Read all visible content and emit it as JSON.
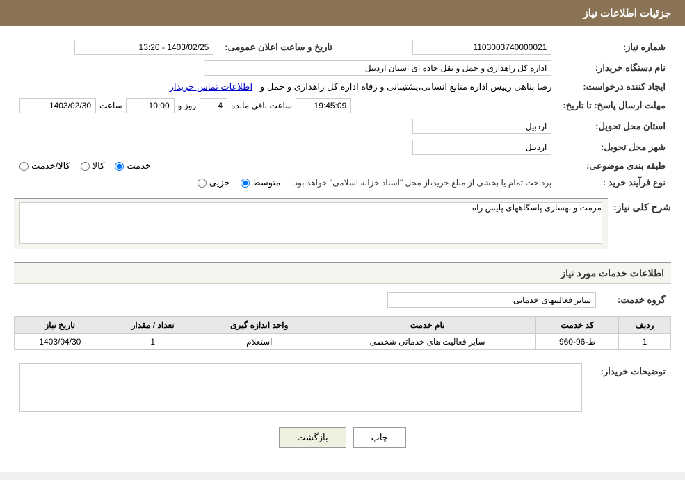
{
  "header": {
    "title": "جزئیات اطلاعات نیاز"
  },
  "fields": {
    "need_number_label": "شماره نیاز:",
    "need_number_value": "1103003740000021",
    "announce_date_label": "تاریخ و ساعت اعلان عمومی:",
    "announce_date_value": "1403/02/25 - 13:20",
    "buyer_org_label": "نام دستگاه خریدار:",
    "buyer_org_value": "اداره کل راهداری و حمل و نقل جاده ای استان اردبیل",
    "creator_label": "ایجاد کننده درخواست:",
    "creator_value": "رضا بناهی رییس اداره منابع انسانی،پشتیبانی و رفاه اداره کل راهداری و حمل و",
    "creator_link": "اطلاعات تماس خریدار",
    "deadline_label": "مهلت ارسال پاسخ: تا تاریخ:",
    "deadline_date": "1403/02/30",
    "deadline_time_label": "ساعت",
    "deadline_time": "10:00",
    "deadline_day_label": "روز و",
    "deadline_days": "4",
    "deadline_remaining_label": "ساعت باقی مانده",
    "deadline_remaining": "19:45:09",
    "province_label": "استان محل تحویل:",
    "province_value": "اردبیل",
    "city_label": "شهر محل تحویل:",
    "city_value": "اردبیل",
    "category_label": "طبقه بندی موضوعی:",
    "category_options": [
      "کالا",
      "خدمت",
      "کالا/خدمت"
    ],
    "category_selected": "خدمت",
    "purchase_type_label": "نوع فرآیند خرید :",
    "purchase_type_options": [
      "جزیی",
      "متوسط"
    ],
    "purchase_type_selected": "متوسط",
    "purchase_type_note": "پرداخت تمام یا بخشی از مبلغ خرید،از محل \"اسناد خزانه اسلامی\" خواهد بود."
  },
  "need_description": {
    "section_label": "شرح کلی نیاز:",
    "value": "مرمت و بهسازی پاسگاههای پلیس راه"
  },
  "services_section": {
    "title": "اطلاعات خدمات مورد نیاز",
    "service_group_label": "گروه خدمت:",
    "service_group_value": "سایر فعالیتهای خدماتی",
    "table_headers": [
      "ردیف",
      "کد خدمت",
      "نام خدمت",
      "واحد اندازه گیری",
      "تعداد / مقدار",
      "تاریخ نیاز"
    ],
    "table_rows": [
      {
        "row_num": "1",
        "service_code": "ط-96-960",
        "service_name": "سایر فعالیت های خدماتی شخصی",
        "unit": "استعلام",
        "quantity": "1",
        "date": "1403/04/30"
      }
    ]
  },
  "buyer_notes": {
    "label": "توضیحات خریدار:",
    "value": ""
  },
  "buttons": {
    "print": "چاپ",
    "back": "بازگشت"
  }
}
